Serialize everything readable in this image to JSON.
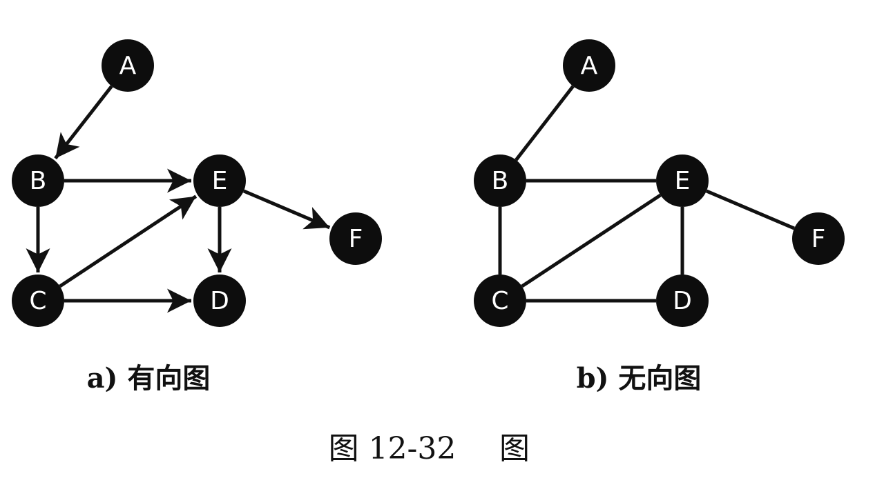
{
  "colors": {
    "node_fill": "#0d0d0d",
    "node_label": "#ffffff",
    "edge": "#111111",
    "text": "#111111",
    "background": "#ffffff"
  },
  "directed_graph": {
    "subcaption": "a) 有向图",
    "nodes": [
      "A",
      "B",
      "C",
      "D",
      "E",
      "F"
    ],
    "edges": [
      {
        "from": "A",
        "to": "B"
      },
      {
        "from": "B",
        "to": "E"
      },
      {
        "from": "B",
        "to": "C"
      },
      {
        "from": "C",
        "to": "E"
      },
      {
        "from": "C",
        "to": "D"
      },
      {
        "from": "E",
        "to": "D"
      },
      {
        "from": "E",
        "to": "F"
      }
    ]
  },
  "undirected_graph": {
    "subcaption": "b) 无向图",
    "nodes": [
      "A",
      "B",
      "C",
      "D",
      "E",
      "F"
    ],
    "edges": [
      {
        "from": "A",
        "to": "B"
      },
      {
        "from": "B",
        "to": "E"
      },
      {
        "from": "B",
        "to": "C"
      },
      {
        "from": "C",
        "to": "E"
      },
      {
        "from": "C",
        "to": "D"
      },
      {
        "from": "E",
        "to": "D"
      },
      {
        "from": "E",
        "to": "F"
      }
    ]
  },
  "figure_caption": {
    "number": "图 12-32",
    "title": "图"
  }
}
